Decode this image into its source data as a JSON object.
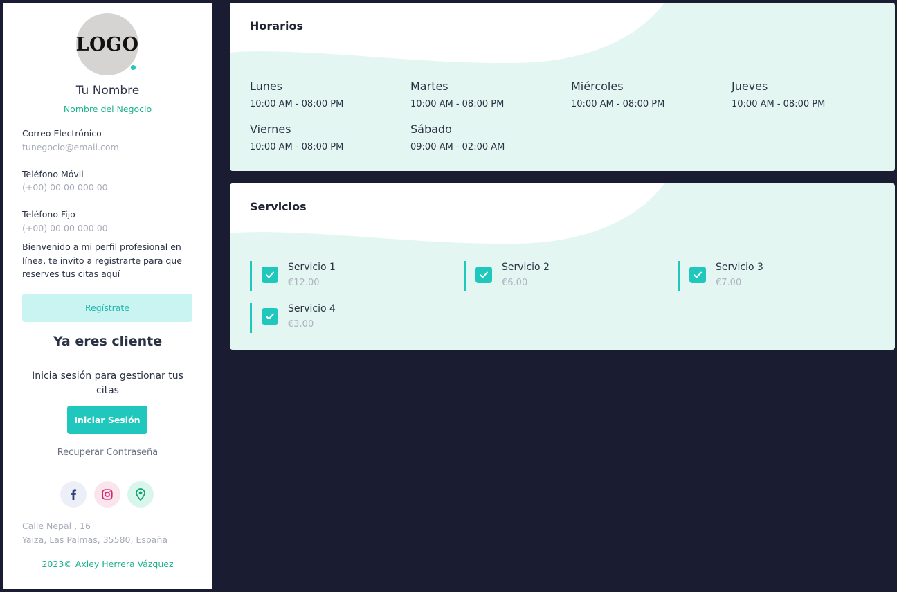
{
  "profile": {
    "logo_text": "LOGO",
    "name": "Tu Nombre",
    "business": "Nombre del Negocio",
    "email_label": "Correo Electrónico",
    "email_value": "tunegocio@email.com",
    "mobile_label": "Teléfono Móvil",
    "mobile_value": "(+00) 00 00 000 00",
    "landline_label": "Teléfono Fijo",
    "landline_value": "(+00) 00 00 000 00",
    "welcome": "Bienvenido a mi perfil profesional en línea, te invito a registrarte para que reserves tus citas aquí",
    "register_label": "Regístrate",
    "client_title": "Ya eres cliente",
    "login_text": "Inicia sesión para gestionar tus citas",
    "login_label": "Iniciar Sesión",
    "recover_label": "Recuperar Contraseña",
    "social": [
      "facebook-icon",
      "instagram-icon",
      "map-pin-icon"
    ],
    "address_line1": "Calle Nepal , 16",
    "address_line2": "Yaiza, Las Palmas, 35580, España",
    "copyright": "2023© Axley Herrera Vázquez"
  },
  "hours": {
    "title": "Horarios",
    "days": [
      {
        "day": "Lunes",
        "hours": "10:00 AM - 08:00 PM"
      },
      {
        "day": "Martes",
        "hours": "10:00 AM - 08:00 PM"
      },
      {
        "day": "Miércoles",
        "hours": "10:00 AM - 08:00 PM"
      },
      {
        "day": "Jueves",
        "hours": "10:00 AM - 08:00 PM"
      },
      {
        "day": "Viernes",
        "hours": "10:00 AM - 08:00 PM"
      },
      {
        "day": "Sábado",
        "hours": "09:00 AM - 02:00 AM"
      }
    ]
  },
  "services": {
    "title": "Servicios",
    "items": [
      {
        "name": "Servicio 1",
        "price": "€12.00"
      },
      {
        "name": "Servicio 2",
        "price": "€6.00"
      },
      {
        "name": "Servicio 3",
        "price": "€7.00"
      },
      {
        "name": "Servicio 4",
        "price": "€3.00"
      }
    ]
  },
  "colors": {
    "accent": "#20c7bd",
    "accent_text": "#1ab08c",
    "background": "#1a1d32",
    "card_bg": "#e3f6f1"
  }
}
